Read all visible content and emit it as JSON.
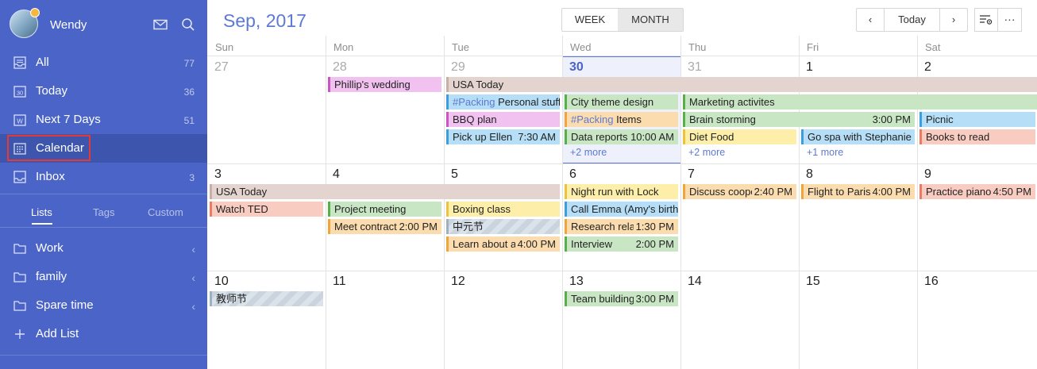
{
  "user": {
    "name": "Wendy"
  },
  "nav": [
    {
      "label": "All",
      "count": "77",
      "icon": "inbox-stack-icon"
    },
    {
      "label": "Today",
      "count": "36",
      "icon": "calendar-30-icon"
    },
    {
      "label": "Next 7 Days",
      "count": "51",
      "icon": "calendar-w-icon"
    },
    {
      "label": "Calendar",
      "count": "",
      "icon": "calendar-grid-icon"
    },
    {
      "label": "Inbox",
      "count": "3",
      "icon": "inbox-icon"
    }
  ],
  "tabs": [
    "Lists",
    "Tags",
    "Custom"
  ],
  "lists": [
    {
      "label": "Work"
    },
    {
      "label": "family"
    },
    {
      "label": "Spare time"
    }
  ],
  "add_list": "Add List",
  "header": {
    "title": "Sep, 2017",
    "week": "WEEK",
    "month": "MONTH",
    "today": "Today",
    "prev": "‹",
    "next": "›",
    "more": "···"
  },
  "weekdays": [
    "Sun",
    "Mon",
    "Tue",
    "Wed",
    "Thu",
    "Fri",
    "Sat"
  ],
  "weeks": [
    [
      "27",
      "28",
      "29",
      "30",
      "31",
      "1",
      "2"
    ],
    [
      "3",
      "4",
      "5",
      "6",
      "7",
      "8",
      "9"
    ],
    [
      "10",
      "11",
      "12",
      "13",
      "14",
      "15",
      "16"
    ]
  ],
  "events": {
    "phillips_wedding": {
      "title": "Phillip's wedding"
    },
    "usa_today_1": {
      "title": "USA Today"
    },
    "packing_personal": {
      "tag": "#Packing",
      "title": " Personal stuff"
    },
    "bbq_plan": {
      "title": "BBQ plan"
    },
    "pickup_ellen": {
      "title": "Pick up Ellen f",
      "time": "7:30 AM"
    },
    "city_theme": {
      "title": "City theme design"
    },
    "packing_items": {
      "tag": "#Packing",
      "title": " Items"
    },
    "data_reports": {
      "title": "Data reports",
      "time": "10:00 AM"
    },
    "wed_more": {
      "title": "+2 more"
    },
    "marketing": {
      "title": "Marketing activites"
    },
    "brainstorming": {
      "title": "Brain storming",
      "time": "3:00 PM"
    },
    "diet_food": {
      "title": "Diet Food"
    },
    "thu_more": {
      "title": "+2 more"
    },
    "go_spa": {
      "title": "Go spa with Stephanie"
    },
    "fri_more": {
      "title": "+1 more"
    },
    "picnic": {
      "title": "Picnic"
    },
    "books": {
      "title": "Books to read"
    },
    "usa_today_2": {
      "title": "USA Today"
    },
    "watch_ted": {
      "title": "Watch TED"
    },
    "project_meeting": {
      "title": "Project meeting"
    },
    "meet_contract": {
      "title": "Meet contract",
      "time": "2:00 PM"
    },
    "boxing": {
      "title": "Boxing class"
    },
    "zhongyuan": {
      "title": "中元节"
    },
    "learn_about": {
      "title": "Learn about a",
      "time": "4:00 PM"
    },
    "night_run": {
      "title": "Night run with Lock"
    },
    "call_emma": {
      "title": "Call Emma (Amy's birth"
    },
    "research": {
      "title": "Research relat",
      "time": "1:30 PM"
    },
    "interview": {
      "title": "Interview",
      "time": "2:00 PM"
    },
    "discuss": {
      "title": "Discuss coope",
      "time": "2:40 PM"
    },
    "flight": {
      "title": "Flight to Paris",
      "time": "4:00 PM"
    },
    "piano": {
      "title": "Practice piano",
      "time": "4:50 PM"
    },
    "teachers_day": {
      "title": "教师节"
    },
    "team_building": {
      "title": "Team building",
      "time": "3:00 PM"
    }
  }
}
